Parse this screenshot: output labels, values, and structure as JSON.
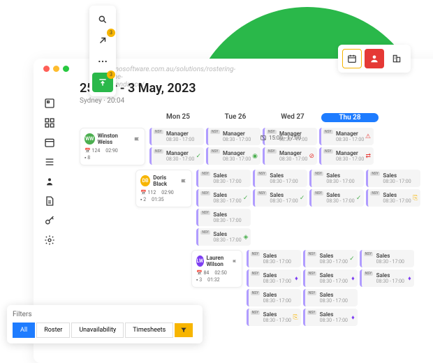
{
  "url": "elmosoftware.com.au/solutions/rostering-time-attendance/",
  "date_range": "25 Apr - 3 May, 2023",
  "subtitle": "Sydney · 20:04",
  "badges": {
    "arrow": "3",
    "upload": "3"
  },
  "days": [
    {
      "label": "Mon 25"
    },
    {
      "label": "Tue 26"
    },
    {
      "label": "Wed 27"
    },
    {
      "label": "Thu 28",
      "active": true
    }
  ],
  "blocked": "15:00 - 17:00",
  "employees": [
    {
      "initials": "WW",
      "name": "Winston Weiss",
      "color": "#4caf50",
      "stats": {
        "hours": "124",
        "rate": "02:90",
        "shifts": "8"
      },
      "shifts": [
        [
          {
            "role": "Manager",
            "time": "08:30 - 17:00"
          },
          {
            "role": "Manager",
            "time": "08:30 - 17:00",
            "ic": "✓",
            "c": "#4caf50"
          }
        ],
        [
          {
            "role": "Manager",
            "time": "08:30 - 17:00"
          },
          {
            "role": "Manager",
            "time": "08:30 - 17:00",
            "ic": "◉",
            "c": "#4caf50"
          }
        ],
        [
          {
            "role": "Manager",
            "time": "08:30 - 17:00"
          },
          {
            "role": "Manager",
            "time": "08:30 - 17:00",
            "ic": "⊘",
            "c": "#e53935"
          }
        ],
        [
          {
            "role": "Manager",
            "time": "08:30 - 17:00",
            "ic": "⚠",
            "c": "#e53935"
          },
          {
            "role": "Manager",
            "time": "08:30 - 17:00",
            "ic": "⇄",
            "c": "#e53935"
          }
        ]
      ]
    },
    {
      "initials": "DB",
      "name": "Doris Black",
      "color": "#f7b500",
      "stats": {
        "hours": "112",
        "rate": "02:90",
        "shifts": "2",
        "extra": "01:35"
      },
      "shifts": [
        [
          {
            "role": "Sales",
            "time": "08:30 - 17:00"
          },
          {
            "role": "Sales",
            "time": "08:30 - 17:00",
            "ic": "✓",
            "c": "#4caf50"
          }
        ],
        [
          {
            "role": "Sales",
            "time": "08:30 - 17:00"
          },
          {
            "role": "Sales",
            "time": "08:30 - 17:00",
            "ic": "✓",
            "c": "#4caf50"
          }
        ],
        [
          {
            "role": "Sales",
            "time": "08:30 - 17:00"
          },
          {
            "role": "Sales",
            "time": "08:30 - 17:00",
            "ic": "✓",
            "c": "#4caf50"
          }
        ],
        [
          {
            "role": "Sales",
            "time": "08:30 - 17:00"
          },
          {
            "role": "Sales",
            "time": "08:30 - 17:00",
            "ic": "⎘",
            "c": "#f7b500"
          }
        ],
        [
          {
            "role": "Sales",
            "time": "08:30 - 17:00"
          },
          {
            "role": "Sales",
            "time": "08:30 - 17:00",
            "ic": "◈",
            "c": "#4caf50"
          }
        ]
      ]
    },
    {
      "initials": "LW",
      "name": "Lauren Wilson",
      "color": "#7e3ff2",
      "stats": {
        "hours": "84",
        "rate": "02:50",
        "shifts": "3",
        "extra": "01:32"
      },
      "shifts": [
        [
          {
            "role": "Sales",
            "time": "08:30 - 17:00"
          },
          {
            "role": "Sales",
            "time": "08:30 - 17:00",
            "ic": "♦",
            "c": "#7e3ff2"
          }
        ],
        [
          {
            "role": "Sales",
            "time": "08:30 - 17:00",
            "ic": "✓",
            "c": "#4caf50"
          },
          {
            "role": "Sales",
            "time": "08:30 - 17:00",
            "ic": "♦",
            "c": "#7e3ff2"
          }
        ],
        [
          {
            "role": "Sales",
            "time": "08:30 - 17:00"
          },
          {
            "role": "Sales",
            "time": "08:30 - 17:00",
            "ic": "♦",
            "c": "#7e3ff2"
          }
        ],
        [
          {
            "role": "Sales",
            "time": "08:30 - 17:00"
          },
          {
            "role": "Sales",
            "time": "08:30 - 17:00",
            "ic": "⎘",
            "c": "#f7b500"
          }
        ],
        [
          {
            "role": "Sales",
            "time": "08:30 - 17:00"
          },
          {
            "role": "Sales",
            "time": "08:30 - 17:00",
            "ic": "♦",
            "c": "#7e3ff2"
          }
        ]
      ]
    }
  ],
  "filters": {
    "title": "Filters",
    "tabs": [
      "All",
      "Roster",
      "Unavailability",
      "Timesheets"
    ]
  },
  "tag": "NSY"
}
